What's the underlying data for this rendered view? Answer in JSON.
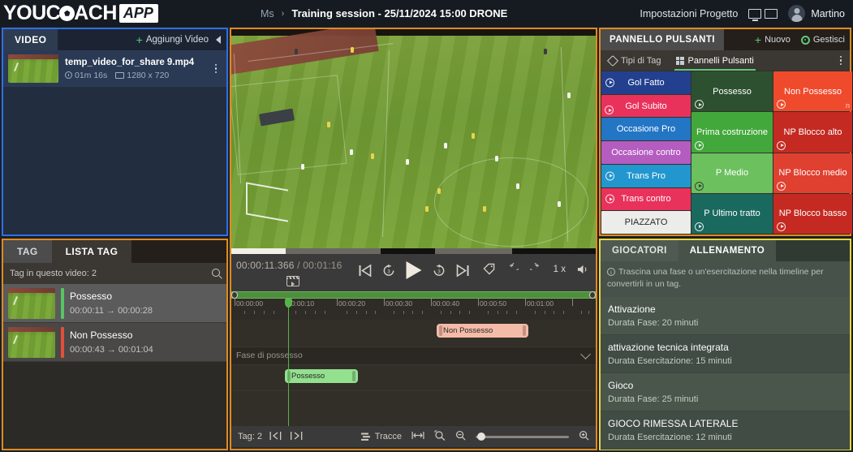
{
  "topbar": {
    "logo_primary": "YOUC",
    "logo_secondary": "ACH",
    "logo_badge": "APP",
    "breadcrumb_root": "Ms",
    "breadcrumb_sep": "›",
    "breadcrumb_current": "Training session - 25/11/2024 15:00 DRONE",
    "settings_label": "Impostazioni Progetto",
    "user_name": "Martino"
  },
  "video_panel": {
    "title": "VIDEO",
    "add_label": "Aggiungi Video",
    "add_plus": "+",
    "border_color": "#2f6fe4",
    "items": [
      {
        "name": "temp_video_for_share 9.mp4",
        "duration": "01m 16s",
        "resolution": "1280 x 720"
      }
    ]
  },
  "tag_panel": {
    "border_color": "#e08a21",
    "tabs": [
      {
        "label": "TAG",
        "active": false
      },
      {
        "label": "LISTA TAG",
        "active": true
      }
    ],
    "search_placeholder": "Tag in questo video: 2",
    "count_label": "Tag in questo video: 2",
    "items": [
      {
        "name": "Possesso",
        "range": "00:00:11 → 00:00:28",
        "color": "#55c663"
      },
      {
        "name": "Non Possesso",
        "range": "00:00:43 → 00:01:04",
        "color": "#e3503a"
      }
    ]
  },
  "player": {
    "current_time": "00:00:11.366",
    "total_separator": "/",
    "total_time": "00:01:16",
    "rate": "1 x",
    "progress_percent": 15,
    "controls": [
      "skip-previous-icon",
      "rewind-3-icon",
      "play-icon",
      "forward-3-icon",
      "skip-next-icon"
    ],
    "right_controls": [
      "tag-icon",
      "undo-icon",
      "redo-icon",
      "playback-rate",
      "volume-icon"
    ]
  },
  "timeline": {
    "ruler_labels": [
      "00:00:00",
      "00:00:10",
      "00:00:20",
      "00:00:30",
      "00:00:40",
      "00:00:50",
      "00:01:00"
    ],
    "ruler_seconds": [
      0,
      10,
      20,
      30,
      40,
      50,
      60
    ],
    "total_seconds": 76,
    "playhead_time": "00:00:11.366",
    "playhead_seconds": 11.366,
    "track_label": "Fase di possesso",
    "clips": [
      {
        "label": "Non Possesso",
        "start": 43,
        "end": 64,
        "color": "#f4bba8",
        "row": 0
      },
      {
        "label": "Possesso",
        "start": 11,
        "end": 28,
        "color": "#93e08f",
        "row": 1
      }
    ],
    "bottom": {
      "tag_count_label": "Tag: 2",
      "prev_tag_icon": "prev-tag-icon",
      "next_tag_icon": "next-tag-icon",
      "tracks_label": "Tracce",
      "fit_icon": "fit-width-icon",
      "zoom_selection_icon": "zoom-selection-icon",
      "zoom_out_icon": "zoom-out-icon",
      "zoom_in_icon": "zoom-in-icon",
      "zoom_value": 3
    }
  },
  "button_panel": {
    "border_color": "#e08a21",
    "title": "PANNELLO PULSANTI",
    "new_label": "Nuovo",
    "new_plus": "+",
    "manage_label": "Gestisci",
    "subtabs": [
      {
        "label": "Tipi di Tag",
        "active": false
      },
      {
        "label": "Pannelli Pulsanti",
        "active": true
      }
    ],
    "edge_letter": "n",
    "columns": [
      {
        "buttons": [
          {
            "label": "Gol Fatto",
            "color": "#23408f",
            "flex": 1,
            "badge": "left",
            "dark": false
          },
          {
            "label": "Gol Subito",
            "color": "#e8325c",
            "flex": 1,
            "badge": "left",
            "dark": false
          },
          {
            "label": "Occasione Pro",
            "color": "#2376c4",
            "flex": 1,
            "badge": "none",
            "dark": false
          },
          {
            "label": "Occasione contro",
            "color": "#b45cc0",
            "flex": 1,
            "badge": "none",
            "dark": false
          },
          {
            "label": "Trans Pro",
            "color": "#2296ce",
            "flex": 1,
            "badge": "left",
            "dark": false
          },
          {
            "label": "Trans contro",
            "color": "#e8325c",
            "flex": 1,
            "badge": "left",
            "dark": false
          },
          {
            "label": "PIAZZATO",
            "color": "#ececea",
            "flex": 1,
            "badge": "none",
            "dark": true
          }
        ]
      },
      {
        "buttons": [
          {
            "label": "Possesso",
            "color": "#2d5130",
            "flex": 1,
            "badge": "bottom",
            "dark": false
          },
          {
            "label": "Prima costruzione",
            "color": "#43a83c",
            "flex": 1,
            "badge": "bottom",
            "dark": false
          },
          {
            "label": "P Medio",
            "color": "#6cc05e",
            "flex": 1,
            "badge": "bottom",
            "dark": false
          },
          {
            "label": "P Ultimo tratto",
            "color": "#19695f",
            "flex": 1,
            "badge": "bottom",
            "dark": false
          }
        ]
      },
      {
        "buttons": [
          {
            "label": "Non Possesso",
            "color": "#f04a2d",
            "flex": 1,
            "badge": "bottom",
            "dark": false
          },
          {
            "label": "NP Blocco alto",
            "color": "#c42a22",
            "flex": 1,
            "badge": "bottom",
            "dark": false
          },
          {
            "label": "NP Blocco medio",
            "color": "#e04030",
            "flex": 1,
            "badge": "bottom",
            "dark": false
          },
          {
            "label": "NP Blocco basso",
            "color": "#c42a22",
            "flex": 1,
            "badge": "bottom",
            "dark": false
          }
        ]
      }
    ]
  },
  "training_panel": {
    "border_color": "#e8d63c",
    "tabs": [
      {
        "label": "GIOCATORI",
        "active": false
      },
      {
        "label": "ALLENAMENTO",
        "active": true
      }
    ],
    "note": "Trascina una fase o un'esercitazione nella timeline per convertirli in un tag.",
    "items": [
      {
        "title": "Attivazione",
        "sub": "Durata Fase: 20 minuti"
      },
      {
        "title": "attivazione tecnica integrata",
        "sub": "Durata Esercitazione: 15 minuti"
      },
      {
        "title": "Gioco",
        "sub": "Durata Fase: 25 minuti"
      },
      {
        "title": "GIOCO RIMESSA LATERALE",
        "sub": "Durata Esercitazione: 12 minuti"
      }
    ]
  }
}
